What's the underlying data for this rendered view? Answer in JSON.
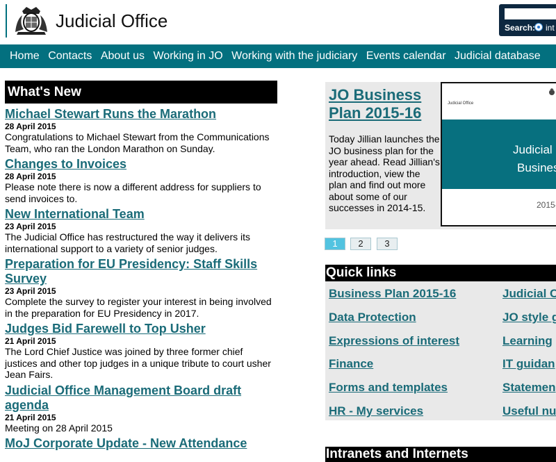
{
  "header": {
    "site_title": "Judicial Office",
    "search_label": "Search:",
    "search_option": "int",
    "search_value": ""
  },
  "nav": {
    "items": [
      "Home",
      "Contacts",
      "About us",
      "Working in JO",
      "Working with the judiciary",
      "Events calendar",
      "Judicial database"
    ]
  },
  "whats_new": {
    "heading": "What's New",
    "items": [
      {
        "title": "Michael Stewart Runs the Marathon",
        "date": "28 April 2015",
        "desc": "Congratulations to Michael Stewart from the Communications Team, who ran the London Marathon on Sunday."
      },
      {
        "title": "Changes to Invoices",
        "date": "28 April 2015",
        "desc": "Please note there is now a different address for suppliers to send invoices to."
      },
      {
        "title": "New International Team",
        "date": "23 April 2015",
        "desc": "The Judicial Office has restructured the way it delivers its international support to a variety of senior judges."
      },
      {
        "title": "Preparation for EU Presidency: Staff Skills Survey",
        "date": "23 April 2015",
        "desc": "Complete the survey to register your interest in being involved in the preparation for EU Presidency in 2017."
      },
      {
        "title": "Judges Bid Farewell to Top Usher",
        "date": "21 April 2015",
        "desc": "The Lord Chief Justice was joined by three former chief justices and other top judges in a unique tribute to court usher Jean Fairs."
      },
      {
        "title": "Judicial Office Management Board draft agenda",
        "date": "21 April 2015",
        "desc": "Meeting on 28 April 2015"
      },
      {
        "title": "MoJ Corporate Update - New Attendance",
        "date": "",
        "desc": ""
      }
    ]
  },
  "feature": {
    "title": "JO Business Plan 2015-16",
    "desc": "Today Jillian launches the JO business plan for the year ahead. Read Jillian's introduction, view the plan and find out more about some of our successes in 2014-15.",
    "image_small_text": "Judicial Office",
    "image_line1": "Judicial O",
    "image_line2": "Busines",
    "image_year": "2015-"
  },
  "pager": {
    "pages": [
      "1",
      "2",
      "3"
    ],
    "active": "1"
  },
  "quick_links": {
    "heading": "Quick links",
    "col1": [
      "Business Plan 2015-16",
      "Data Protection",
      "Expressions of interest",
      "Finance",
      "Forms and templates",
      "HR - My services"
    ],
    "col2": [
      "Judicial C",
      "JO style g",
      "Learning",
      "IT guidan",
      "Statemen",
      "Useful nu"
    ]
  },
  "intranets": {
    "heading": "Intranets and Internets"
  },
  "colors": {
    "nav_teal": "#03707f",
    "link_teal": "#1a6b78",
    "search_navy": "#0d2840"
  }
}
